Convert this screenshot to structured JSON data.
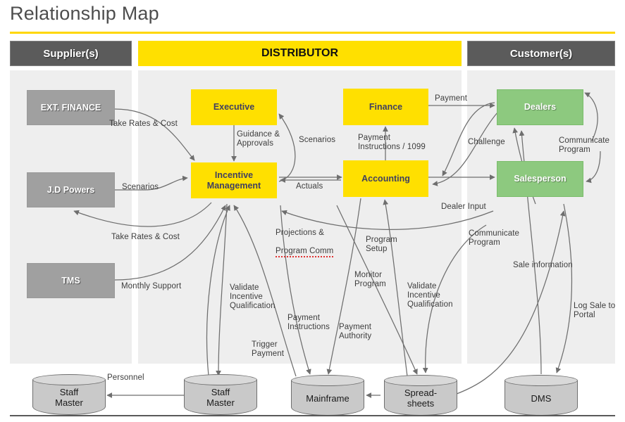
{
  "page": {
    "title": "Relationship Map",
    "accent_color": "#ffd700",
    "header_dark_color": "#5b5b5b",
    "header_yellow_color": "#ffe000",
    "panel_color": "#eeeeee"
  },
  "columns": [
    {
      "id": "supplier",
      "label": "Supplier(s)",
      "style": "dark"
    },
    {
      "id": "distributor",
      "label": "DISTRIBUTOR",
      "style": "yellow"
    },
    {
      "id": "customer",
      "label": "Customer(s)",
      "style": "dark"
    }
  ],
  "nodes": {
    "ext_finance": {
      "label": "EXT. FINANCE",
      "color": "#a0a0a0",
      "column": "supplier"
    },
    "jd_powers": {
      "label": "J.D Powers",
      "color": "#a0a0a0",
      "column": "supplier"
    },
    "tms": {
      "label": "TMS",
      "color": "#a0a0a0",
      "column": "supplier"
    },
    "executive": {
      "label": "Executive",
      "color": "#ffe000",
      "column": "distributor"
    },
    "incentive_management": {
      "label": "Incentive\nManagement",
      "color": "#ffe000",
      "column": "distributor"
    },
    "finance": {
      "label": "Finance",
      "color": "#ffe000",
      "column": "distributor"
    },
    "accounting": {
      "label": "Accounting",
      "color": "#ffe000",
      "column": "distributor"
    },
    "dealers": {
      "label": "Dealers",
      "color": "#8dc97f",
      "column": "customer"
    },
    "salesperson": {
      "label": "Salesperson",
      "color": "#8dc97f",
      "column": "customer"
    }
  },
  "datastores": {
    "staff_master_left": {
      "label": "Staff\nMaster"
    },
    "staff_master_mid": {
      "label": "Staff\nMaster"
    },
    "mainframe": {
      "label": "Mainframe"
    },
    "spreadsheets": {
      "label": "Spread-\nsheets"
    },
    "dms": {
      "label": "DMS"
    }
  },
  "edge_labels": {
    "take_rates_cost_top": "Take Rates & Cost",
    "scenarios_jd": "Scenarios",
    "take_rates_cost_bottom": "Take Rates & Cost",
    "monthly_support": "Monthly Support",
    "guidance_approvals": "Guidance &\nApprovals",
    "scenarios_exec": "Scenarios",
    "actuals": "Actuals",
    "payment_instructions_1099": "Payment\nInstructions  / 1099",
    "payment": "Payment",
    "challenge": "Challenge",
    "communicate_program_top": "Communicate\nProgram",
    "dealer_input": "Dealer Input",
    "communicate_program_mid": "Communicate\nProgram",
    "sale_information": "Sale information",
    "log_sale_to_portal": "Log Sale to\nPortal",
    "projections_program_comm_line1": "Projections &",
    "projections_program_comm_line2": "Program Comm",
    "program_setup": "Program\nSetup",
    "monitor_program": "Monitor\nProgram",
    "validate_incentive_left": "Validate\nIncentive\nQualification",
    "validate_incentive_right": "Validate\nIncentive\nQualification",
    "payment_instructions_ds": "Payment\nInstructions",
    "payment_authority": "Payment\nAuthority",
    "trigger_payment": "Trigger\nPayment",
    "personnel": "Personnel"
  }
}
